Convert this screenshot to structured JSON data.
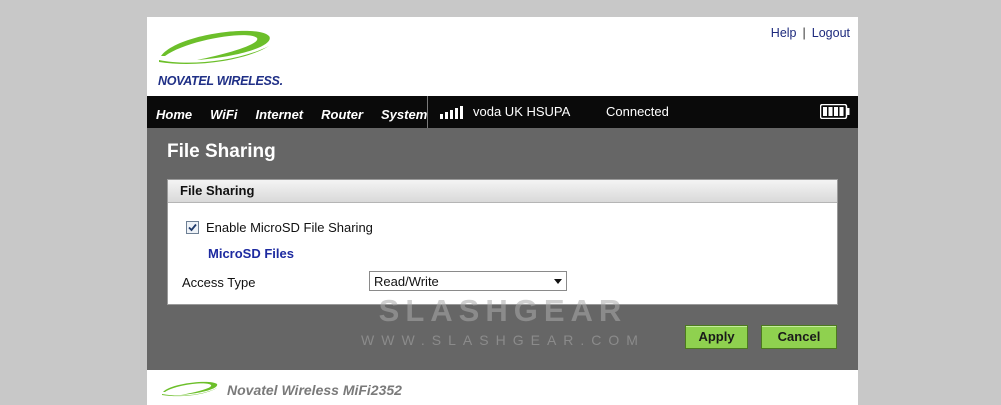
{
  "header": {
    "brand": "NOVATEL WIRELESS.",
    "help_label": "Help",
    "separator": "|",
    "logout_label": "Logout"
  },
  "nav": {
    "items": [
      {
        "label": "Home"
      },
      {
        "label": "WiFi"
      },
      {
        "label": "Internet"
      },
      {
        "label": "Router"
      },
      {
        "label": "System"
      }
    ],
    "carrier": "voda UK  HSUPA",
    "status": "Connected",
    "signal_icon": "signal-bars-icon",
    "battery_icon": "battery-icon"
  },
  "main": {
    "title": "File Sharing",
    "panel": {
      "header": "File Sharing",
      "enable_label": "Enable MicroSD File Sharing",
      "enable_checked": true,
      "files_link": "MicroSD Files",
      "access_label": "Access Type",
      "access_value": "Read/Write"
    },
    "apply_label": "Apply",
    "cancel_label": "Cancel"
  },
  "watermark": {
    "line1": "SLASHGEAR",
    "line2": "WWW.SLASHGEAR.COM"
  },
  "footer": {
    "text": "Novatel Wireless MiFi2352"
  },
  "colors": {
    "accent_green": "#8fd14f",
    "nav_bg": "#0a0a0a",
    "content_bg": "#666666",
    "link_blue": "#1d2aa0",
    "logo_green": "#6cbf2a"
  }
}
